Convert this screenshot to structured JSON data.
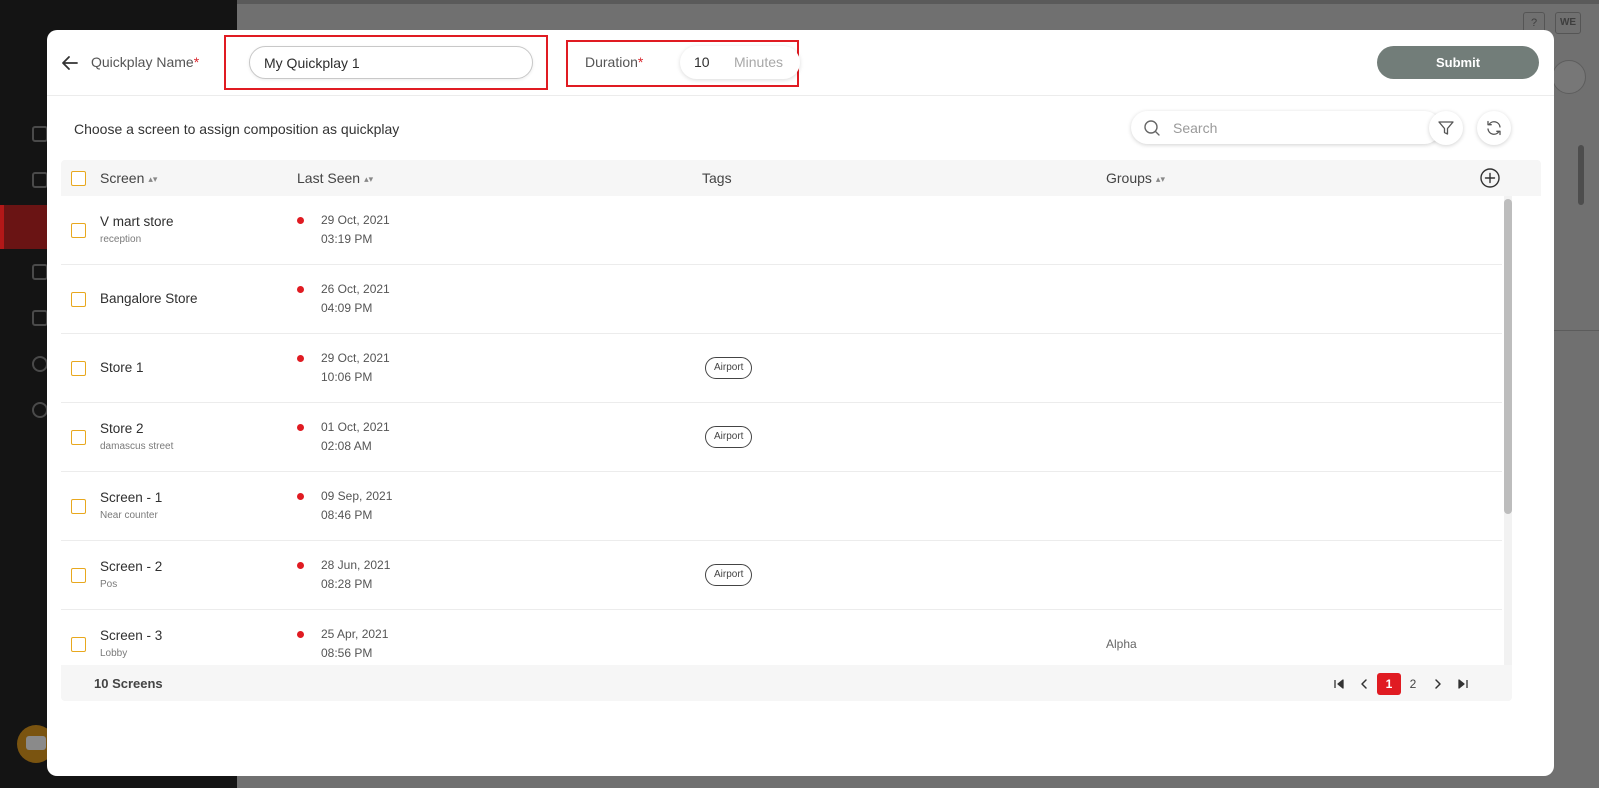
{
  "background": {
    "help_label": "?",
    "avatar_label": "WE"
  },
  "header": {
    "quickplay_name_label": "Quickplay Name",
    "quickplay_name_value": "My Quickplay 1",
    "required_mark": "*",
    "duration_label": "Duration",
    "duration_value": "10",
    "duration_unit": "Minutes",
    "submit_label": "Submit"
  },
  "toolbar": {
    "instruction": "Choose a screen to assign composition as quickplay",
    "search_placeholder": "Search"
  },
  "table": {
    "columns": {
      "screen": "Screen",
      "last_seen": "Last Seen",
      "tags": "Tags",
      "groups": "Groups"
    },
    "rows": [
      {
        "name": "V mart store",
        "sub": "reception",
        "date": "29 Oct, 2021",
        "time": "03:19 PM",
        "tag": "",
        "group": ""
      },
      {
        "name": "Bangalore Store",
        "sub": "",
        "date": "26 Oct, 2021",
        "time": "04:09 PM",
        "tag": "",
        "group": ""
      },
      {
        "name": "Store 1",
        "sub": "",
        "date": "29 Oct, 2021",
        "time": "10:06 PM",
        "tag": "Airport",
        "group": ""
      },
      {
        "name": "Store 2",
        "sub": "damascus street",
        "date": "01 Oct, 2021",
        "time": "02:08 AM",
        "tag": "Airport",
        "group": ""
      },
      {
        "name": "Screen - 1",
        "sub": "Near counter",
        "date": "09 Sep, 2021",
        "time": "08:46 PM",
        "tag": "",
        "group": ""
      },
      {
        "name": "Screen - 2",
        "sub": "Pos",
        "date": "28 Jun, 2021",
        "time": "08:28 PM",
        "tag": "Airport",
        "group": ""
      },
      {
        "name": "Screen - 3",
        "sub": "Lobby",
        "date": "25 Apr, 2021",
        "time": "08:56 PM",
        "tag": "",
        "group": "Alpha"
      }
    ],
    "status_color": "#e01b22"
  },
  "footer": {
    "count_label": "10 Screens",
    "pages": [
      "1",
      "2"
    ],
    "current_page": "1"
  },
  "colors": {
    "accent_red": "#e01b22",
    "submit_bg": "#727d79",
    "checkbox_border": "#e8a81e"
  }
}
